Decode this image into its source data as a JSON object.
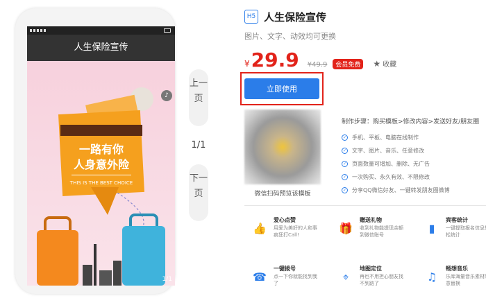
{
  "phone": {
    "nav_title": "人生保险宣传",
    "slogan_line1": "一路有你",
    "slogan_line2": "人身意外险",
    "slogan_en": "THIS IS THE BEST CHOICE",
    "page_indicator": "1/1"
  },
  "pager": {
    "prev_label": "上一页",
    "count": "1/1",
    "next_label": "下一页"
  },
  "product": {
    "type_badge": "H5",
    "title": "人生保险宣传",
    "subtitle": "图片、文字、动效均可更换",
    "currency": "¥",
    "price": "29.9",
    "original_price": "¥49.9",
    "vip_badge": "会员免费",
    "favorite_label": "收藏",
    "use_button": "立即使用"
  },
  "qr": {
    "caption": "微信扫码预览该模板"
  },
  "steps": {
    "title": "制作步骤：购买模板>修改内容>发送好友/朋友圈",
    "items": [
      "手机、平板、电脑在线制作",
      "文字、图片、音乐、任意修改",
      "页面数量可增加、删除、无广告",
      "一次购买、永久有效、不限修改",
      "分享QQ微信好友、一键转发朋友圈微博"
    ]
  },
  "features": [
    {
      "icon": "thumbs-up-icon",
      "title": "爱心点赞",
      "desc": "用爱为美好的人和事疯狂打Call!"
    },
    {
      "icon": "gift-icon",
      "title": "赠送礼物",
      "desc": "收到礼物能提现余额到微信账号"
    },
    {
      "icon": "chart-icon",
      "title": "宾客统计",
      "desc": "一键提取报名信息轻松统计"
    },
    {
      "icon": "phone-icon",
      "title": "一键拨号",
      "desc": "点一下你就能找到我了"
    },
    {
      "icon": "location-icon",
      "title": "地图定位",
      "desc": "再也不用担心朋友找不到路了"
    },
    {
      "icon": "music-icon",
      "title": "畅想音乐",
      "desc": "乐库海量音乐素材随意替换"
    }
  ],
  "colors": {
    "accent": "#2b7de9",
    "price": "#e2231a",
    "poster_bg": "#f9d9e3",
    "banner": "#f5a01e"
  }
}
